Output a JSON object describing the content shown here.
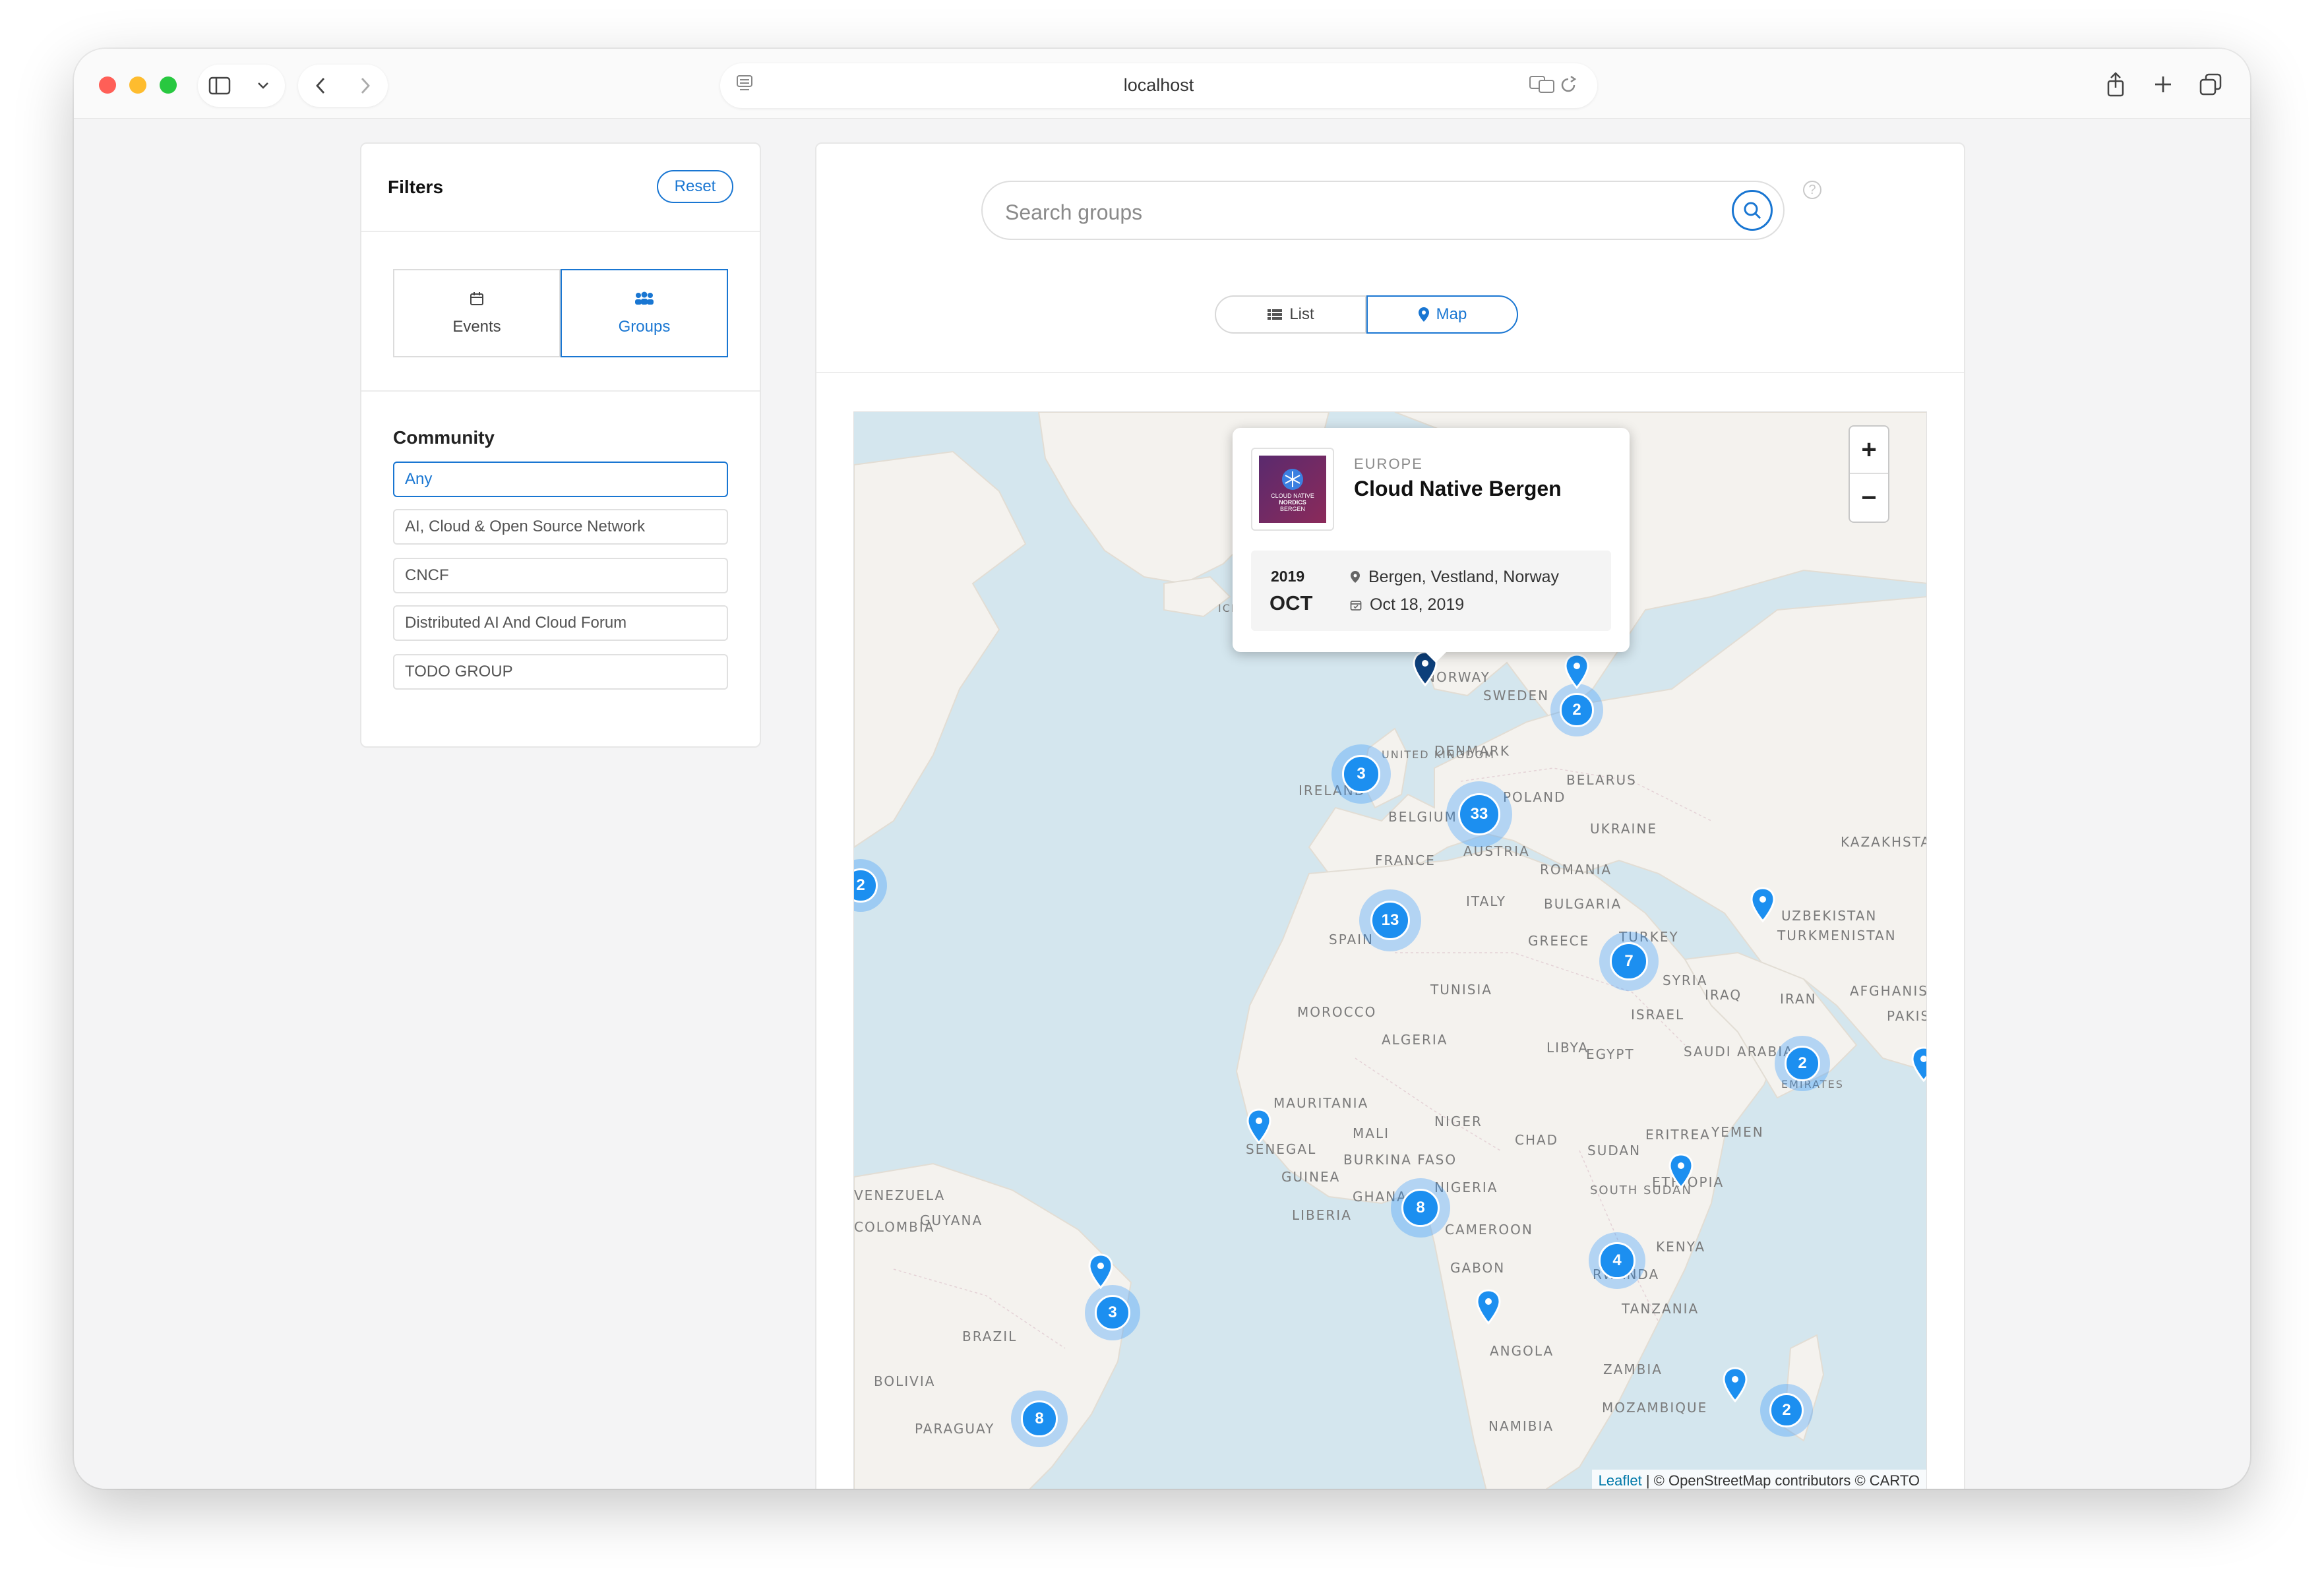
{
  "browser": {
    "url": "localhost"
  },
  "filters": {
    "title": "Filters",
    "reset_label": "Reset",
    "tabs": [
      {
        "label": "Events",
        "icon": "calendar-icon"
      },
      {
        "label": "Groups",
        "icon": "users-icon",
        "active": true
      }
    ],
    "community_title": "Community",
    "community_options": [
      "Any",
      "AI, Cloud & Open Source Network",
      "CNCF",
      "Distributed AI And Cloud Forum",
      "TODO GROUP"
    ],
    "selected_community": "Any"
  },
  "search": {
    "placeholder": "Search groups"
  },
  "view_toggle": {
    "list_label": "List",
    "map_label": "Map",
    "active": "Map"
  },
  "map": {
    "labels": [
      "NORWAY",
      "SWEDEN",
      "DENMARK",
      "IRELAND",
      "UNITED KINGDOM",
      "BELARUS",
      "POLAND",
      "BELGIUM",
      "UKRAINE",
      "KAZAKHSTAN",
      "FRANCE",
      "AUSTRIA",
      "ROMANIA",
      "ITALY",
      "BULGARIA",
      "UZBEKISTAN",
      "TURKMENISTAN",
      "SPAIN",
      "GREECE",
      "TURKEY",
      "SYRIA",
      "IRAQ",
      "IRAN",
      "AFGHANISTAN",
      "PAKISTAN",
      "TUNISIA",
      "MOROCCO",
      "ISRAEL",
      "ALGERIA",
      "LIBYA",
      "EGYPT",
      "SAUDI ARABIA",
      "EMIRATES",
      "MAURITANIA",
      "MALI",
      "NIGER",
      "CHAD",
      "SUDAN",
      "ERITREA",
      "YEMEN",
      "SENEGAL",
      "BURKINA FASO",
      "GUINEA",
      "ETHIOPIA",
      "GHANA",
      "NIGERIA",
      "SOUTH SUDAN",
      "LIBERIA",
      "CAMEROON",
      "VENEZUELA",
      "GUYANA",
      "COLOMBIA",
      "KENYA",
      "GABON",
      "RWANDA",
      "TANZANIA",
      "BRAZIL",
      "ANGOLA",
      "ZAMBIA",
      "BOLIVIA",
      "MOZAMBIQUE",
      "NAMIBIA",
      "PARAGUAY",
      "ICELAND"
    ],
    "clusters": [
      "2",
      "3",
      "33",
      "13",
      "7",
      "2",
      "8",
      "4",
      "3",
      "8",
      "2",
      "2"
    ],
    "zoom_in": "+",
    "zoom_out": "−",
    "attribution_leaflet": "Leaflet",
    "attribution_rest": " | © OpenStreetMap contributors © CARTO"
  },
  "popup": {
    "region": "EUROPE",
    "name": "Cloud Native Bergen",
    "logo_text": [
      "CLOUD NATIVE",
      "NORDICS",
      "BERGEN"
    ],
    "year": "2019",
    "month": "OCT",
    "location": "Bergen, Vestland, Norway",
    "date": "Oct 18, 2019"
  },
  "colors": {
    "accent": "#1976d2",
    "cluster": "#1c8ff0",
    "water": "#d4e6ee",
    "land": "#f4f2ee"
  }
}
